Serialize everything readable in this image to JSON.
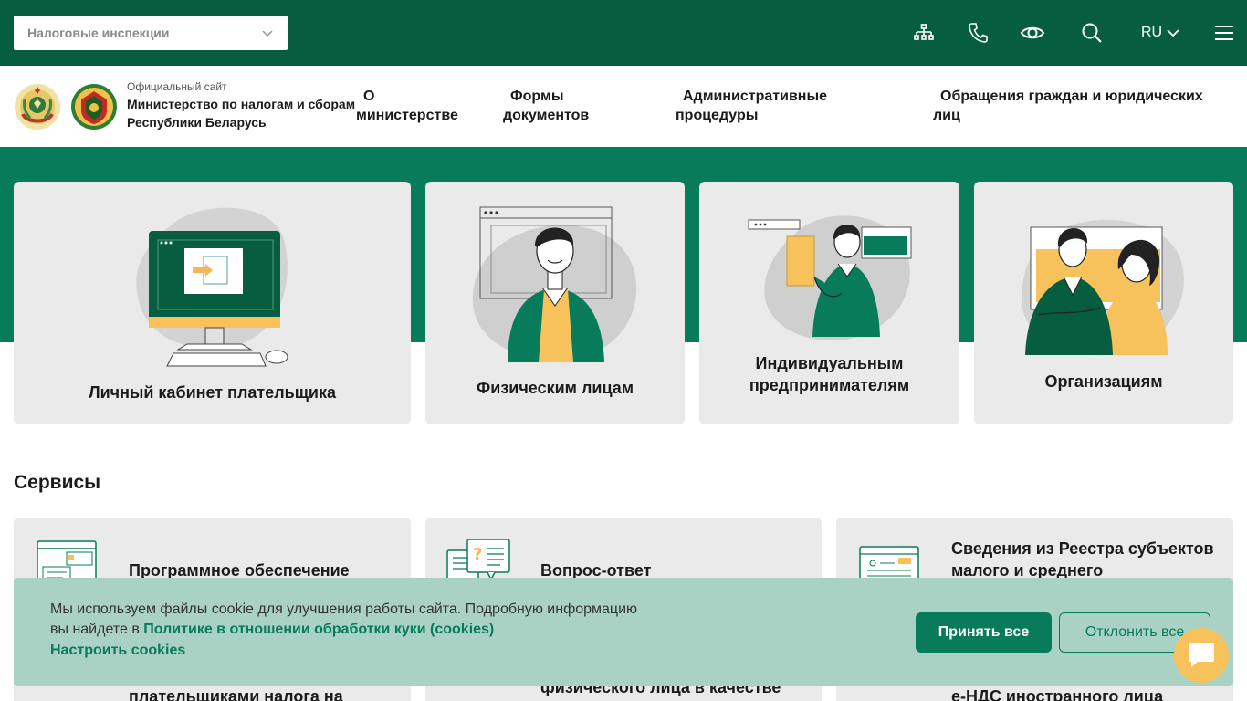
{
  "topbar": {
    "select_value": "Налоговые инспекции",
    "icons": [
      "sitemap-icon",
      "phone-icon",
      "eye-icon",
      "search-icon",
      "menu-icon"
    ],
    "language": "RU"
  },
  "header": {
    "official_label": "Официальный сайт",
    "org_name_line1": "Министерство по налогам и сборам",
    "org_name_line2": "Республики Беларусь",
    "nav": [
      {
        "line1": "О",
        "line2": "министерстве"
      },
      {
        "line1": "Формы",
        "line2": "документов"
      },
      {
        "line1": "Административные",
        "line2": "процедуры"
      },
      {
        "line1": "Обращения граждан и юридических",
        "line2": "лиц"
      }
    ]
  },
  "categories": [
    {
      "title": "Личный кабинет плательщика"
    },
    {
      "title": "Физическим лицам"
    },
    {
      "title_line1": "Индивидуальным",
      "title_line2": "предпринимателям"
    },
    {
      "title": "Организациям"
    }
  ],
  "services": {
    "heading": "Сервисы",
    "items": [
      {
        "title": "Программное обеспечение"
      },
      {
        "title": "Вопрос-ответ"
      },
      {
        "title_line1": "Сведения из Реестра субъектов",
        "title_line2": "малого и среднего"
      }
    ],
    "partial_row": [
      "плательщиками налога на",
      "физического лица в качестве",
      "е-НДС иностранного лица"
    ]
  },
  "cookie": {
    "text_line1": "Мы используем файлы cookie для улучшения работы сайта. Подробную информацию",
    "text_line2_prefix": "вы найдете в ",
    "policy_link": "Политике в отношении обработки куки (cookies)",
    "configure": "Настроить cookies",
    "accept": "Принять все",
    "decline": "Отклонить все"
  },
  "colors": {
    "topbar": "#075d3f",
    "accent": "#077b5a",
    "card": "#eaeaea",
    "cookie_bg": "#a9d2c5",
    "chat": "#f7c25c",
    "yellow": "#f7c25c"
  }
}
